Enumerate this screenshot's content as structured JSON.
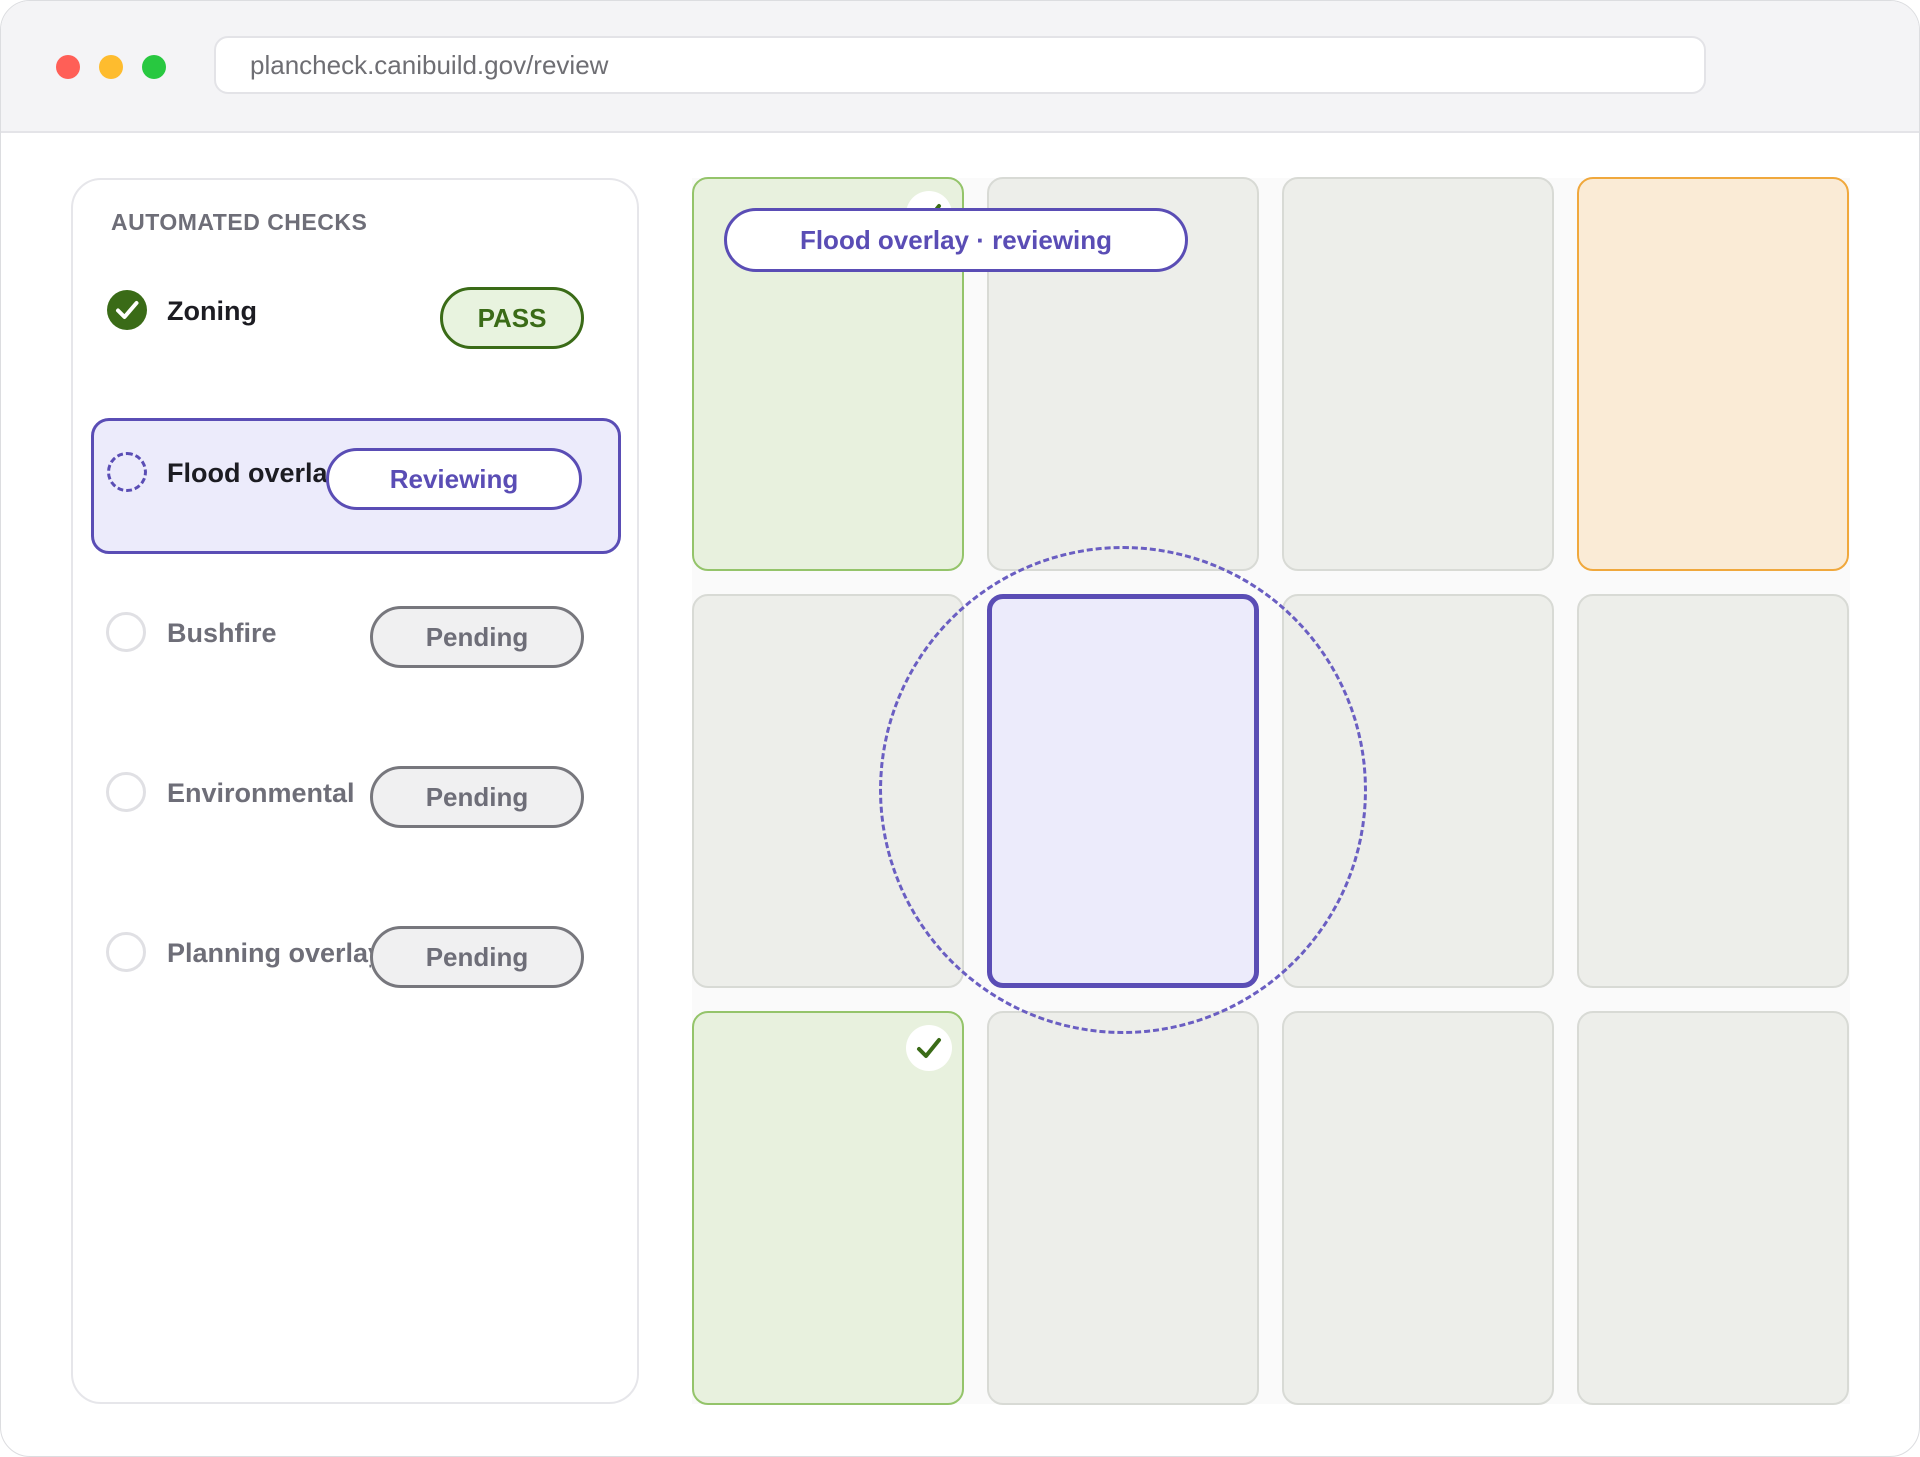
{
  "browser": {
    "url": "plancheck.canibuild.gov/review"
  },
  "checks_panel": {
    "title": "AUTOMATED CHECKS",
    "items": [
      {
        "label": "Zoning",
        "status": "PASS",
        "state": "pass"
      },
      {
        "label": "Flood overlay",
        "status": "Reviewing",
        "state": "reviewing"
      },
      {
        "label": "Bushfire",
        "status": "Pending",
        "state": "pending"
      },
      {
        "label": "Environmental",
        "status": "Pending",
        "state": "pending"
      },
      {
        "label": "Planning overlay",
        "status": "Pending",
        "state": "pending"
      }
    ]
  },
  "site_grid": {
    "columns": 4,
    "rows": 3,
    "tile_states": [
      [
        "pass",
        "neutral",
        "neutral",
        "warn"
      ],
      [
        "neutral",
        "active",
        "neutral",
        "neutral"
      ],
      [
        "pass",
        "neutral",
        "neutral",
        "neutral"
      ]
    ],
    "callout": "Flood overlay · reviewing"
  },
  "colors": {
    "pass": "#3a6b17",
    "reviewing": "#5a4db5",
    "warning": "#f0a83c",
    "pending": "#77777d"
  },
  "icons": {
    "pass": "check-icon",
    "reviewing": "spinner-dashed-icon",
    "pending": "empty-circle-icon"
  }
}
